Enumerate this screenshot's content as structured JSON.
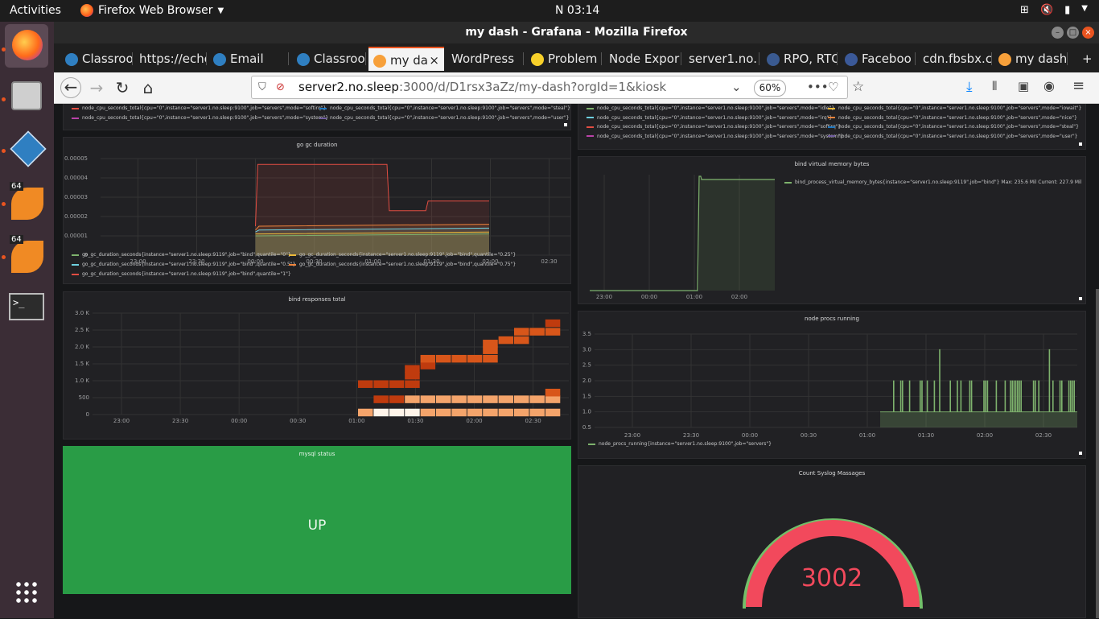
{
  "ubuntu": {
    "activities": "Activities",
    "app_name": "Firefox Web Browser",
    "clock": "N 03:14"
  },
  "browser": {
    "window_title": "my dash - Grafana - Mozilla Firefox",
    "tabs": [
      {
        "label": "Classroo"
      },
      {
        "label": "https://echo"
      },
      {
        "label": "Email"
      },
      {
        "label": "Classroo"
      },
      {
        "label": "my da",
        "active": true
      },
      {
        "label": "WordPress"
      },
      {
        "label": "Problem"
      },
      {
        "label": "Node Expor"
      },
      {
        "label": "server1.no."
      },
      {
        "label": "RPO, RTO"
      },
      {
        "label": "Faceboo"
      },
      {
        "label": "cdn.fbsbx.c"
      },
      {
        "label": "my dash"
      }
    ],
    "url_host": "server2.no.sleep",
    "url_rest": ":3000/d/D1rsx3aZz/my-dash?orgId=1&kiosk",
    "zoom": "60%"
  },
  "panels": {
    "cpu_left_legend": [
      {
        "text": "node_cpu_seconds_total{cpu=\"0\",instance=\"server1.no.sleep:9100\",job=\"servers\",mode=\"softirq\"}",
        "color": "#e24d42"
      },
      {
        "text": "node_cpu_seconds_total{cpu=\"0\",instance=\"server1.no.sleep:9100\",job=\"servers\",mode=\"steal\"}",
        "color": "#1f78c1"
      },
      {
        "text": "node_cpu_seconds_total{cpu=\"0\",instance=\"server1.no.sleep:9100\",job=\"servers\",mode=\"system\"}",
        "color": "#ba43a9"
      },
      {
        "text": "node_cpu_seconds_total{cpu=\"0\",instance=\"server1.no.sleep:9100\",job=\"servers\",mode=\"user\"}",
        "color": "#705da0"
      }
    ],
    "cpu_right_legend": [
      {
        "text": "node_cpu_seconds_total{cpu=\"0\",instance=\"server1.no.sleep:9100\",job=\"servers\",mode=\"idle\"}",
        "color": "#7eb26d"
      },
      {
        "text": "node_cpu_seconds_total{cpu=\"0\",instance=\"server1.no.sleep:9100\",job=\"servers\",mode=\"iowait\"}",
        "color": "#eab839"
      },
      {
        "text": "node_cpu_seconds_total{cpu=\"0\",instance=\"server1.no.sleep:9100\",job=\"servers\",mode=\"irq\"}",
        "color": "#6ed0e0"
      },
      {
        "text": "node_cpu_seconds_total{cpu=\"0\",instance=\"server1.no.sleep:9100\",job=\"servers\",mode=\"nice\"}",
        "color": "#ef843c"
      },
      {
        "text": "node_cpu_seconds_total{cpu=\"0\",instance=\"server1.no.sleep:9100\",job=\"servers\",mode=\"softirq\"}",
        "color": "#e24d42"
      },
      {
        "text": "node_cpu_seconds_total{cpu=\"0\",instance=\"server1.no.sleep:9100\",job=\"servers\",mode=\"steal\"}",
        "color": "#1f78c1"
      },
      {
        "text": "node_cpu_seconds_total{cpu=\"0\",instance=\"server1.no.sleep:9100\",job=\"servers\",mode=\"system\"}",
        "color": "#ba43a9"
      },
      {
        "text": "node_cpu_seconds_total{cpu=\"0\",instance=\"server1.no.sleep:9100\",job=\"servers\",mode=\"user\"}",
        "color": "#705da0"
      }
    ],
    "gc": {
      "title": "go gc duration",
      "legend": [
        {
          "text": "go_gc_duration_seconds{instance=\"server1.no.sleep:9119\",job=\"bind\",quantile=\"0\"}",
          "color": "#7eb26d"
        },
        {
          "text": "go_gc_duration_seconds{instance=\"server1.no.sleep:9119\",job=\"bind\",quantile=\"0.25\"}",
          "color": "#eab839"
        },
        {
          "text": "go_gc_duration_seconds{instance=\"server1.no.sleep:9119\",job=\"bind\",quantile=\"0.5\"}",
          "color": "#6ed0e0"
        },
        {
          "text": "go_gc_duration_seconds{instance=\"server1.no.sleep:9119\",job=\"bind\",quantile=\"0.75\"}",
          "color": "#ef843c"
        },
        {
          "text": "go_gc_duration_seconds{instance=\"server1.no.sleep:9119\",job=\"bind\",quantile=\"1\"}",
          "color": "#e24d42"
        }
      ]
    },
    "bind_resp": {
      "title": "bind responses total"
    },
    "mysql": {
      "title": "mysql status",
      "value": "UP",
      "color": "#299c46"
    },
    "vmem": {
      "title": "bind virtual memory bytes",
      "legend": "bind_process_virtual_memory_bytes{instance=\"server1.no.sleep:9119\",job=\"bind\"}",
      "max": "Max: 235.6 Mil",
      "current": "Current: 227.9 Mil"
    },
    "procs": {
      "title": "node procs running",
      "legend": "node_procs_running{instance=\"server1.no.sleep:9100\",job=\"servers\"}"
    },
    "syslog": {
      "title": "Count Syslog Massages",
      "value": "3002",
      "color": "#f2495c"
    }
  },
  "chart_data": [
    {
      "type": "line",
      "title": "go gc duration",
      "x": [
        "23:00",
        "23:30",
        "00:00",
        "00:30",
        "01:00",
        "01:30",
        "02:00",
        "02:30"
      ],
      "yticks": [
        "0.00005",
        "0.00004",
        "0.00003",
        "0.00002",
        "0.00001",
        "0"
      ],
      "ylim": [
        0,
        5e-05
      ],
      "series": [
        {
          "name": "quantile=\"1\"",
          "points": [
            [
              1.0,
              1.5e-05
            ],
            [
              1.02,
              4.7e-05
            ],
            [
              2.12,
              4.7e-05
            ],
            [
              2.14,
              2.3e-05
            ],
            [
              2.45,
              2.3e-05
            ],
            [
              2.47,
              2.8e-05
            ],
            [
              2.99,
              2.8e-05
            ]
          ]
        },
        {
          "name": "quantile=\"0.75\"",
          "points": [
            [
              1.0,
              1.3e-05
            ],
            [
              1.03,
              1.5e-05
            ],
            [
              2.99,
              1.6e-05
            ]
          ]
        },
        {
          "name": "quantile=\"0.5\"",
          "points": [
            [
              1.0,
              1.2e-05
            ],
            [
              1.03,
              1.3e-05
            ],
            [
              2.99,
              1.4e-05
            ]
          ]
        },
        {
          "name": "quantile=\"0.25\"",
          "points": [
            [
              1.0,
              1.1e-05
            ],
            [
              1.03,
              1.1e-05
            ],
            [
              2.99,
              1.2e-05
            ]
          ]
        },
        {
          "name": "quantile=\"0\"",
          "points": [
            [
              1.0,
              1e-05
            ],
            [
              1.03,
              1e-05
            ],
            [
              2.99,
              1.1e-05
            ]
          ]
        }
      ]
    },
    {
      "type": "heatmap",
      "title": "bind responses total",
      "x": [
        "23:00",
        "23:30",
        "00:00",
        "00:30",
        "01:00",
        "01:30",
        "02:00",
        "02:30"
      ],
      "yticks": [
        "3.0 K",
        "2.5 K",
        "2.0 K",
        "1.5 K",
        "1.0 K",
        "500",
        "0"
      ],
      "ylim": [
        0,
        3000
      ]
    },
    {
      "type": "line",
      "title": "bind virtual memory bytes",
      "x": [
        "23:00",
        "00:00",
        "01:00",
        "02:00"
      ],
      "series": [
        {
          "name": "bind_process_virtual_memory_bytes",
          "points": [
            [
              0,
              0
            ],
            [
              1.12,
              0
            ],
            [
              1.13,
              235.6
            ],
            [
              1.15,
              227.9
            ],
            [
              2.6,
              227.9
            ]
          ]
        }
      ]
    },
    {
      "type": "line",
      "title": "node procs running",
      "x": [
        "23:00",
        "23:30",
        "00:00",
        "00:30",
        "01:00",
        "01:30",
        "02:00",
        "02:30"
      ],
      "yticks": [
        "3.5",
        "3.0",
        "2.5",
        "2.0",
        "1.5",
        "1.0",
        "0.5"
      ],
      "ylim": [
        0.5,
        3.5
      ]
    }
  ]
}
